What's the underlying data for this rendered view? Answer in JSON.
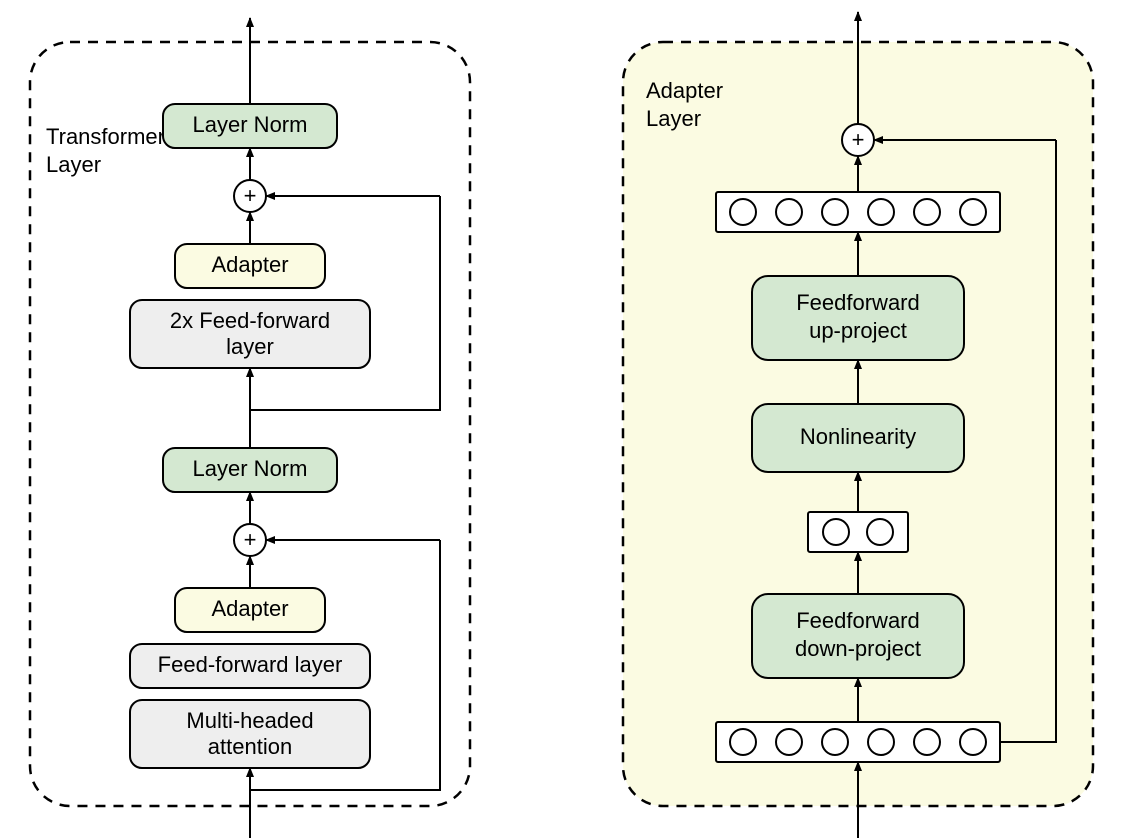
{
  "left": {
    "container_label_l1": "Transformer",
    "container_label_l2": "Layer",
    "layer_norm_top": "Layer Norm",
    "adapter_top": "Adapter",
    "ff2x_l1": "2x Feed-forward",
    "ff2x_l2": "layer",
    "layer_norm_mid": "Layer Norm",
    "adapter_bottom": "Adapter",
    "ff_layer": "Feed-forward layer",
    "mha_l1": "Multi-headed",
    "mha_l2": "attention"
  },
  "right": {
    "container_label_l1": "Adapter",
    "container_label_l2": "Layer",
    "ff_up_l1": "Feedforward",
    "ff_up_l2": "up-project",
    "nonlinearity": "Nonlinearity",
    "ff_down_l1": "Feedforward",
    "ff_down_l2": "down-project"
  },
  "colors": {
    "green": "#d4e8d1",
    "yellow": "#fbfbe2",
    "gray": "#eeeeee",
    "white": "#ffffff"
  }
}
